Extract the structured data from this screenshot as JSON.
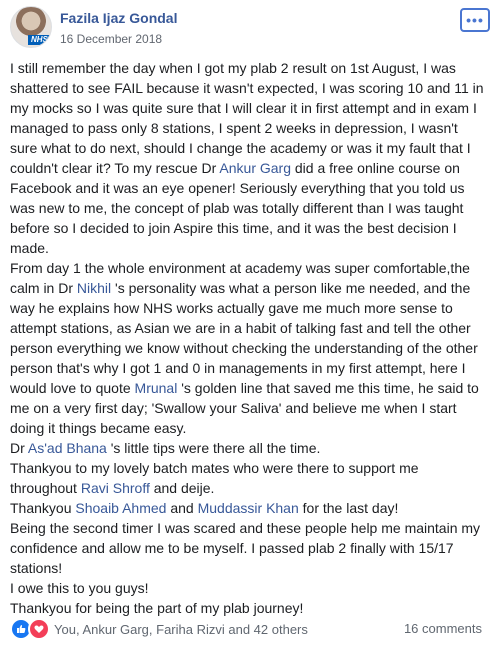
{
  "post": {
    "author": "Fazila Ijaz Gondal",
    "date": "16 December 2018",
    "avatar_badge": "NHS",
    "more_label": "•••"
  },
  "body": {
    "p1": [
      {
        "t": "I still remember the day when I got my plab 2 result on 1st August, I was shattered to see FAIL because it wasn't expected, I was scoring 10 and 11 in my mocks so I was quite sure that I will clear it in first attempt and in exam I managed to pass only 8 stations, I spent 2 weeks in depression, I wasn't sure what to do next, should I change the academy or was it my fault that I couldn't clear it? To my rescue Dr "
      },
      {
        "m": "Ankur Garg"
      },
      {
        "t": " did a free online course on Facebook and it was an eye opener! Seriously everything that you told us was new to me, the concept of plab was totally different than I was taught before so I decided to join Aspire this time, and it was the best decision I made."
      }
    ],
    "p2": [
      {
        "t": "From day 1 the whole environment at academy was super comfortable,the calm in Dr "
      },
      {
        "m": "Nikhil"
      },
      {
        "t": " 's personality was what a person like me needed, and the way he explains how NHS works actually gave me much more sense to attempt stations, as Asian we are in a habit of talking fast and tell the other person everything we know without checking the understanding of the other person that's why I got 1 and 0 in managements in my first attempt, here I would love to quote "
      },
      {
        "m": "Mrunal"
      },
      {
        "t": " 's golden line that saved me this time, he said to me on a very first day; 'Swallow your Saliva' and believe me when I start doing it things became easy."
      }
    ],
    "p3": [
      {
        "t": "Dr "
      },
      {
        "m": "As'ad Bhana"
      },
      {
        "t": " 's little tips were there all the time."
      }
    ],
    "p4": [
      {
        "t": "Thankyou to my lovely batch mates who were there to support me throughout "
      },
      {
        "m": "Ravi Shroff"
      },
      {
        "t": " and deije."
      }
    ],
    "p5": [
      {
        "t": "Thankyou "
      },
      {
        "m": "Shoaib Ahmed"
      },
      {
        "t": " and "
      },
      {
        "m": "Muddassir Khan"
      },
      {
        "t": " for the last day!"
      }
    ],
    "p6": [
      {
        "t": "Being the second timer I was scared and these people help me maintain my confidence and allow me to be myself. I passed plab 2 finally with 15/17 stations!"
      }
    ],
    "p7": [
      {
        "t": "I owe this to you guys!"
      }
    ],
    "p8": [
      {
        "t": "Thankyou for being the part of my plab journey!"
      }
    ]
  },
  "footer": {
    "reactions_text": "You, Ankur Garg, Fariha Rizvi and 42 others",
    "comments": "16 comments",
    "like_icon": "thumbs-up-icon",
    "love_icon": "heart-icon",
    "colors": {
      "like": "#1877f2",
      "love": "#f33e58",
      "link": "#385898"
    }
  }
}
